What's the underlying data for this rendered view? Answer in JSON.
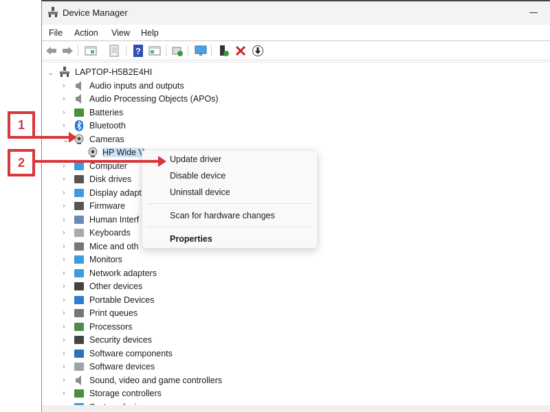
{
  "window": {
    "title": "Device Manager",
    "app_icon": "device-manager-icon"
  },
  "menu": [
    "File",
    "Action",
    "View",
    "Help"
  ],
  "toolbar": {
    "buttons": [
      {
        "name": "back",
        "icon": "back-arrow-icon"
      },
      {
        "name": "forward",
        "icon": "forward-arrow-icon"
      },
      {
        "name": "show-hide-console-tree",
        "icon": "console-tree-icon"
      },
      {
        "name": "properties",
        "icon": "properties-sheet-icon"
      },
      {
        "name": "help",
        "icon": "help-icon"
      },
      {
        "name": "show-hide-action-pane",
        "icon": "action-pane-icon"
      },
      {
        "name": "update-driver",
        "icon": "update-driver-icon"
      },
      {
        "name": "scan-hardware",
        "icon": "monitor-scan-icon"
      },
      {
        "name": "enable-device",
        "icon": "enable-device-icon"
      },
      {
        "name": "uninstall-device",
        "icon": "red-x-icon"
      },
      {
        "name": "disable-device",
        "icon": "down-arrow-circle-icon"
      }
    ]
  },
  "tree": {
    "root": {
      "label": "LAPTOP-H5B2E4HI",
      "icon": "computer-network-icon",
      "expanded": true
    },
    "categories": [
      {
        "label": "Audio inputs and outputs",
        "icon": "speaker-icon"
      },
      {
        "label": "Audio Processing Objects (APOs)",
        "icon": "speaker-icon"
      },
      {
        "label": "Batteries",
        "icon": "battery-icon"
      },
      {
        "label": "Bluetooth",
        "icon": "bluetooth-icon"
      },
      {
        "label": "Cameras",
        "icon": "webcam-icon",
        "expanded": true
      },
      {
        "label": "HP Wide Vision HD Camera",
        "icon": "webcam-icon",
        "child": true,
        "selected": true,
        "visible_text": "HP Wide V"
      },
      {
        "label": "Computer",
        "icon": "monitor-icon"
      },
      {
        "label": "Disk drives",
        "icon": "disk-drive-icon"
      },
      {
        "label": "Display adapters",
        "icon": "display-adapter-icon",
        "visible_text": "Display adapt"
      },
      {
        "label": "Firmware",
        "icon": "firmware-chip-icon"
      },
      {
        "label": "Human Interface Devices",
        "icon": "hid-icon",
        "visible_text": "Human Interf"
      },
      {
        "label": "Keyboards",
        "icon": "keyboard-icon"
      },
      {
        "label": "Mice and other pointing devices",
        "icon": "mouse-icon",
        "visible_text": "Mice and oth"
      },
      {
        "label": "Monitors",
        "icon": "monitor-icon"
      },
      {
        "label": "Network adapters",
        "icon": "network-adapter-icon"
      },
      {
        "label": "Other devices",
        "icon": "unknown-device-icon"
      },
      {
        "label": "Portable Devices",
        "icon": "portable-device-icon"
      },
      {
        "label": "Print queues",
        "icon": "printer-icon"
      },
      {
        "label": "Processors",
        "icon": "processor-icon"
      },
      {
        "label": "Security devices",
        "icon": "security-key-icon"
      },
      {
        "label": "Software components",
        "icon": "software-component-icon"
      },
      {
        "label": "Software devices",
        "icon": "software-device-icon"
      },
      {
        "label": "Sound, video and game controllers",
        "icon": "speaker-icon"
      },
      {
        "label": "Storage controllers",
        "icon": "storage-controller-icon"
      },
      {
        "label": "System devices",
        "icon": "system-devices-icon"
      }
    ]
  },
  "context_menu": {
    "items": [
      {
        "label": "Update driver"
      },
      {
        "label": "Disable device"
      },
      {
        "label": "Uninstall device"
      },
      {
        "separator": true
      },
      {
        "label": "Scan for hardware changes"
      },
      {
        "separator": true
      },
      {
        "label": "Properties",
        "bold": true
      }
    ]
  },
  "annotations": [
    {
      "number": "1",
      "points_to": "Cameras"
    },
    {
      "number": "2",
      "points_to": "Update driver"
    }
  ],
  "colors": {
    "annotation_red": "#d9363a",
    "selection_blue": "#cce4f7",
    "menu_bg": "#f9f9f9"
  }
}
